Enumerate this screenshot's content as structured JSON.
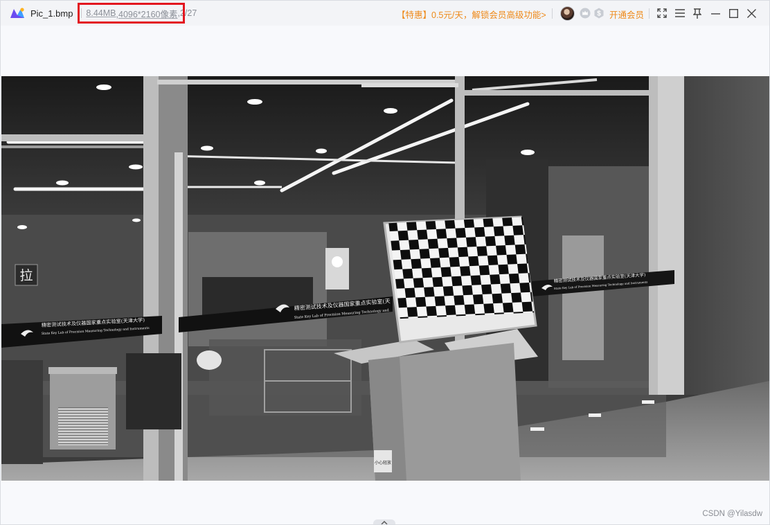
{
  "app": {
    "filename": "Pic_1.bmp",
    "file_size": "8.44MB",
    "dimensions": ",4096*2160像素",
    "page_counter": ",2/27",
    "promo_text": "【特惠】0.5元/天，解锁会员高级功能>",
    "vip_button": "开通会员"
  },
  "icons": {
    "logo": "app-logo-icon",
    "avatar": "user-avatar",
    "badge1": "crown-badge-icon",
    "badge2": "s-badge-icon",
    "fullscreen": "fullscreen-icon",
    "menu": "menu-icon",
    "pin": "pin-icon",
    "minimize": "minimize-icon",
    "maximize": "maximize-icon",
    "close": "close-icon",
    "collapse": "chevron-up-icon"
  },
  "photo": {
    "sign_pull": "拉",
    "banner_left_cn": "精密测试技术及仪器国家重点实验室(天津大学)",
    "banner_left_en": "State Key Lab of Precision Measuring Technology and Instruments",
    "banner_mid_cn": "精密测试技术及仪器国家重点实验室(天",
    "banner_mid_en": "State Key Lab of Precision Measuring Technology and",
    "banner_right_cn": "精密测试技术及仪器国家重点实验室(天津大学)",
    "banner_right_en": "State Key Lab of Precision Measuring Technology and Instruments",
    "box_label": "小心轻放"
  },
  "watermark": "CSDN @Yilasdw",
  "colors": {
    "accent_orange": "#ee8a1a",
    "highlight_red": "#e3161f"
  }
}
